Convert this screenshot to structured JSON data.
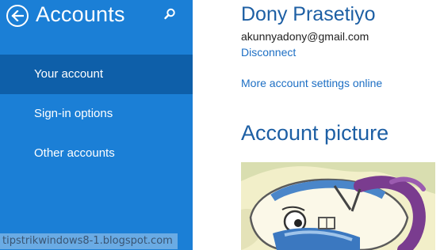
{
  "sidebar": {
    "title": "Accounts",
    "items": [
      {
        "label": "Your account",
        "selected": true
      },
      {
        "label": "Sign-in options",
        "selected": false
      },
      {
        "label": "Other accounts",
        "selected": false
      }
    ]
  },
  "account": {
    "name": "Dony Prasetiyo",
    "email": "akunnyadony@gmail.com",
    "disconnect_label": "Disconnect",
    "more_settings_label": "More account settings online"
  },
  "picture_section": {
    "title": "Account picture"
  },
  "watermark": "tipstrikwindows8-1.blogspot.com",
  "icons": {
    "back": "back-arrow-icon",
    "search": "search-icon"
  },
  "colors": {
    "sidebar_bg": "#1b7fd6",
    "selected_bg": "#0e5fa9",
    "heading": "#1d5fa4",
    "link": "#1d6fc4"
  }
}
